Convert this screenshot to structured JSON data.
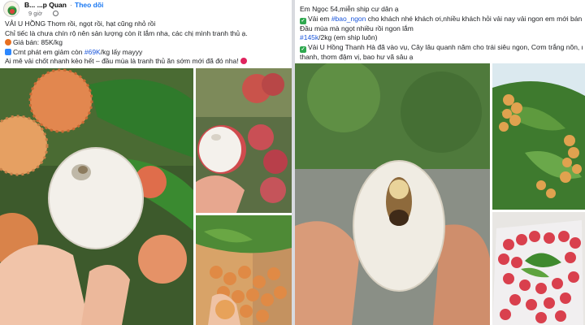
{
  "left_post": {
    "page_name": "B... ...p Quan",
    "separator": "·",
    "follow_label": "Theo dõi",
    "time": "9 giờ",
    "lines": [
      "VẢI U HỒNG Thơm rồi, ngọt rồi, hạt cũng nhỏ rồi",
      "Chỉ tiếc là chưa chín rộ nên sản lượng còn ít lắm nha, các chị mình tranh thủ ạ.",
      "Giá bán: 85K/kg",
      "Cmt phát em giảm còn ",
      "kg lấy mayyy",
      "Ai mê vải chốt nhanh kẻo hết – đầu mùa là tranh thủ ăn sớm mới đã đó nha!"
    ],
    "hashtag_price": "#69K",
    "hashtag_sep": "/"
  },
  "right_post": {
    "lines": [
      "Em Ngọc 54,miễn ship cư dân ạ",
      "Vải em ",
      " cho khách nhé khách ơi,nhiều khách hỏi vải nay vải ngon em mới bán ạ",
      "Đầu mùa mà ngọt nhiều rồi ngon lắm",
      " (em ship luôn)",
      "Vải U Hồng Thanh Hà  đã vào vụ, Cây lâu quanh năm cho trái siêu ngon, Cơm trắng nõn, ngọt",
      "thanh, thơm đậm vị, bao hư vã sâu ạ"
    ],
    "hashtag_bao_ngon": "#bao_ngon",
    "hashtag_price": "#145k",
    "price_unit": "/2kg"
  },
  "icons": {
    "check": "green-check-icon",
    "money": "money-icon",
    "phone": "phone-icon",
    "cherry": "cherry-icon"
  }
}
